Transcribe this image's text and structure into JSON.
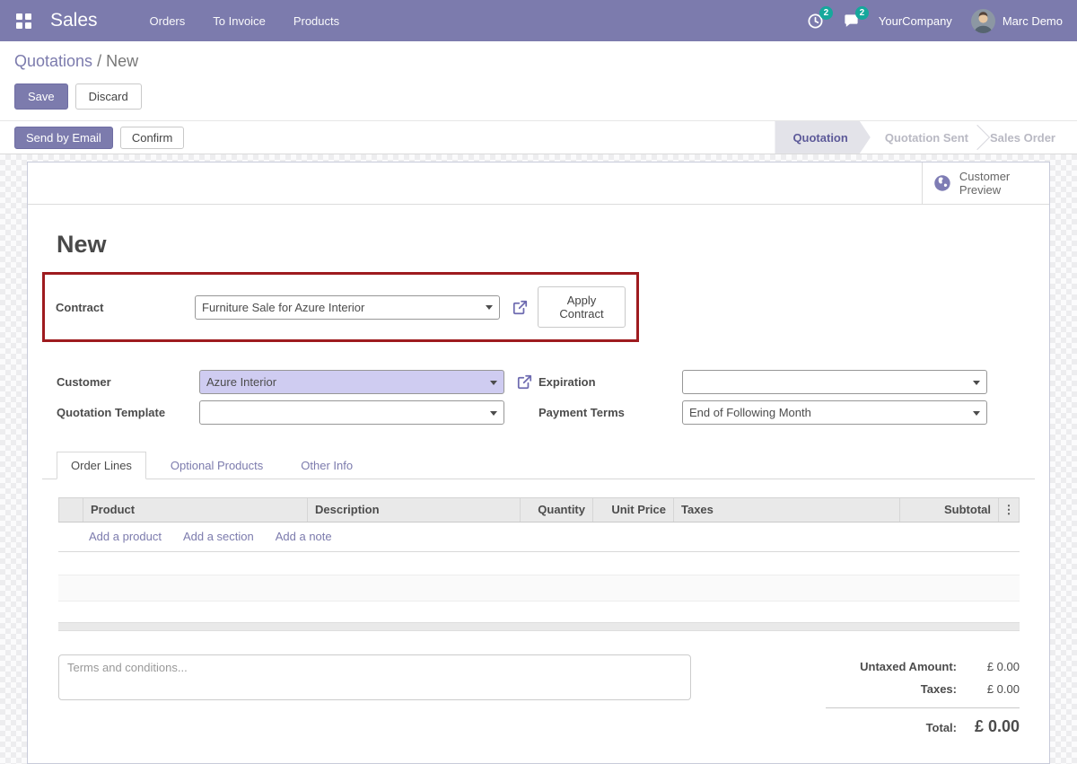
{
  "colors": {
    "brand": "#7c7bad",
    "badge": "#16a89c",
    "highlight-red": "#9e1b1f",
    "field-selected-bg": "#cfccf1",
    "link": "#7c7bad"
  },
  "navbar": {
    "app_name": "Sales",
    "menus": [
      "Orders",
      "To Invoice",
      "Products"
    ],
    "activity_badge": "2",
    "messages_badge": "2",
    "company": "YourCompany",
    "user": "Marc Demo"
  },
  "breadcrumb": {
    "parent": "Quotations",
    "separator": " / ",
    "current": "New"
  },
  "control_buttons": {
    "save": "Save",
    "discard": "Discard"
  },
  "statusbar": {
    "send_by_email": "Send by Email",
    "confirm": "Confirm",
    "steps": {
      "active": "Quotation",
      "step2": "Quotation Sent",
      "step3": "Sales Order"
    }
  },
  "sheet": {
    "preview_button": "Customer Preview",
    "title": "New",
    "contract": {
      "label": "Contract",
      "value": "Furniture Sale for Azure Interior",
      "apply_button": "Apply Contract"
    },
    "fields": {
      "customer": {
        "label": "Customer",
        "value": "Azure Interior"
      },
      "quotation_template": {
        "label": "Quotation Template",
        "value": ""
      },
      "expiration": {
        "label": "Expiration",
        "value": ""
      },
      "payment_terms": {
        "label": "Payment Terms",
        "value": "End of Following Month"
      }
    },
    "tabs": [
      "Order Lines",
      "Optional Products",
      "Other Info"
    ],
    "order_lines": {
      "headers": [
        "Product",
        "Description",
        "Quantity",
        "Unit Price",
        "Taxes",
        "Subtotal"
      ],
      "kebab_glyph": "⋮",
      "add_links": [
        "Add a product",
        "Add a section",
        "Add a note"
      ]
    },
    "terms_placeholder": "Terms and conditions...",
    "totals": {
      "untaxed_label": "Untaxed Amount:",
      "untaxed_value": "£ 0.00",
      "taxes_label": "Taxes:",
      "taxes_value": "£ 0.00",
      "total_label": "Total:",
      "total_value": "£ 0.00"
    }
  }
}
